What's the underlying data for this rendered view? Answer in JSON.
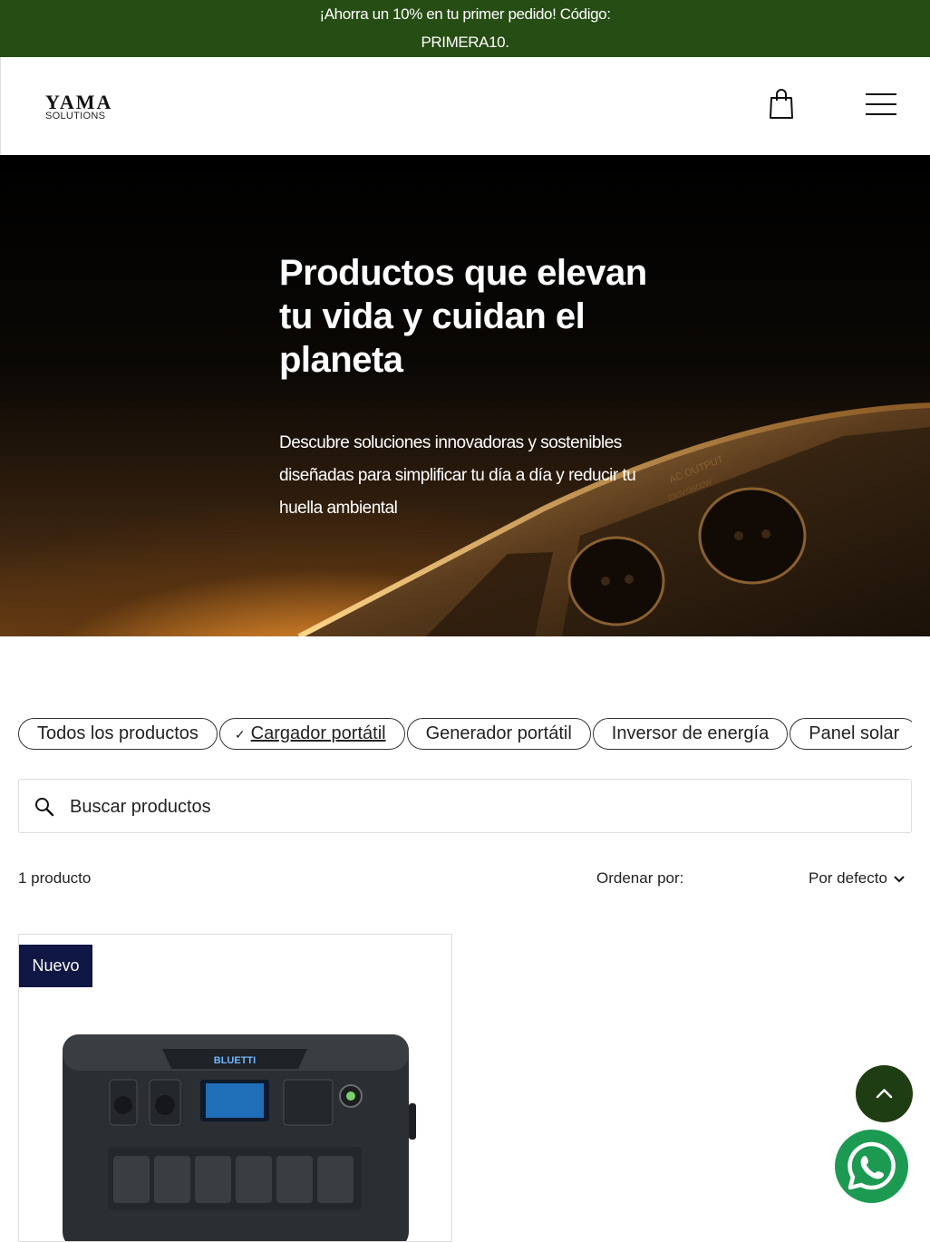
{
  "promo": {
    "line1": "¡Ahorra un 10% en tu primer pedido! Código:",
    "line2": "PRIMERA10."
  },
  "header": {
    "logo_main": "YAMA",
    "logo_sub": "SOLUTIONS",
    "cart_icon": "shopping-bag-icon",
    "menu_icon": "hamburger-menu-icon"
  },
  "hero": {
    "title": "Productos que elevan tu vida y cuidan el planeta",
    "subtitle": "Descubre soluciones innovadoras y sostenibles diseñadas para simplificar tu día a día y reducir tu huella ambiental",
    "image_label_top": "AC OUTPUT",
    "image_label_bottom": "230V/3600W"
  },
  "categories": [
    {
      "label": "Todos los productos",
      "active": false
    },
    {
      "label": "Cargador portátil",
      "active": true
    },
    {
      "label": "Generador portátil",
      "active": false
    },
    {
      "label": "Inversor de energía",
      "active": false
    },
    {
      "label": "Panel solar",
      "active": false
    }
  ],
  "search": {
    "placeholder": "Buscar productos",
    "icon": "search-icon"
  },
  "results": {
    "count": "1 producto",
    "sort_label": "Ordenar por:",
    "sort_value": "Por defecto"
  },
  "products": [
    {
      "badge": "Nuevo",
      "brand": "BLUETTI"
    }
  ],
  "colors": {
    "promo_bg": "#264d14",
    "badge_bg": "#101744",
    "scroll_top_bg": "#1f3d12",
    "whatsapp_bg": "#1d9a52"
  }
}
